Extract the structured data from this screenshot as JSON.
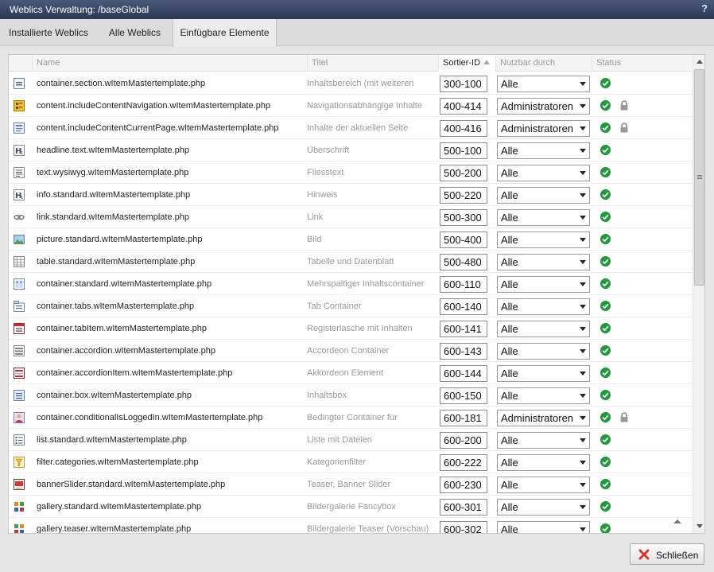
{
  "window": {
    "title": "Weblics Verwaltung: /baseGlobal",
    "help": "?"
  },
  "tabs": [
    {
      "label": "Installierte Weblics"
    },
    {
      "label": "Alle Weblics"
    },
    {
      "label": "Einfügbare Elemente"
    }
  ],
  "table": {
    "headers": {
      "name": "Name",
      "titel": "Titel",
      "sortier_id": "Sortier-ID",
      "nutzbar": "Nutzbar durch",
      "status": "Status"
    },
    "rows": [
      {
        "icon": "section-icon",
        "name": "container.section.wItemMastertemplate.php",
        "titel": "Inhaltsbereich (mit weiteren",
        "sortier_id": "300-100",
        "nutzbar": "Alle",
        "locked": false
      },
      {
        "icon": "navigation-content-icon",
        "name": "content.includeContentNavigation.wItemMastertemplate.php",
        "titel": "Navigationsabhängige Inhalte",
        "sortier_id": "400-414",
        "nutzbar": "Administratoren",
        "locked": true
      },
      {
        "icon": "page-content-icon",
        "name": "content.includeContentCurrentPage.wItemMastertemplate.php",
        "titel": "Inhalte der aktuellen Seite",
        "sortier_id": "400-416",
        "nutzbar": "Administratoren",
        "locked": true
      },
      {
        "icon": "headline-icon",
        "name": "headline.text.wItemMastertemplate.php",
        "titel": "Überschrift",
        "sortier_id": "500-100",
        "nutzbar": "Alle",
        "locked": false
      },
      {
        "icon": "text-icon",
        "name": "text.wysiwyg.wItemMastertemplate.php",
        "titel": "Fliesstext",
        "sortier_id": "500-200",
        "nutzbar": "Alle",
        "locked": false
      },
      {
        "icon": "headline-icon",
        "name": "info.standard.wItemMastertemplate.php",
        "titel": "Hinweis",
        "sortier_id": "500-220",
        "nutzbar": "Alle",
        "locked": false
      },
      {
        "icon": "link-icon",
        "name": "link.standard.wItemMastertemplate.php",
        "titel": "Link",
        "sortier_id": "500-300",
        "nutzbar": "Alle",
        "locked": false
      },
      {
        "icon": "picture-icon",
        "name": "picture.standard.wItemMastertemplate.php",
        "titel": "Bild",
        "sortier_id": "500-400",
        "nutzbar": "Alle",
        "locked": false
      },
      {
        "icon": "table-icon",
        "name": "table.standard.wItemMastertemplate.php",
        "titel": "Tabelle und Datenblatt",
        "sortier_id": "500-480",
        "nutzbar": "Alle",
        "locked": false
      },
      {
        "icon": "columns-icon",
        "name": "container.standard.wItemMastertemplate.php",
        "titel": "Mehrspaltiger Inhaltscontainer",
        "sortier_id": "600-110",
        "nutzbar": "Alle",
        "locked": false
      },
      {
        "icon": "tabs-icon",
        "name": "container.tabs.wItemMastertemplate.php",
        "titel": "Tab Container",
        "sortier_id": "600-140",
        "nutzbar": "Alle",
        "locked": false
      },
      {
        "icon": "tab-item-icon",
        "name": "container.tabItem.wItemMastertemplate.php",
        "titel": "Registerlasche mit Inhalten",
        "sortier_id": "600-141",
        "nutzbar": "Alle",
        "locked": false
      },
      {
        "icon": "accordion-icon",
        "name": "container.accordion.wItemMastertemplate.php",
        "titel": "Accordeon Container",
        "sortier_id": "600-143",
        "nutzbar": "Alle",
        "locked": false
      },
      {
        "icon": "accordion-item-icon",
        "name": "container.accordionItem.wItemMastertemplate.php",
        "titel": "Akkordeon Element",
        "sortier_id": "600-144",
        "nutzbar": "Alle",
        "locked": false
      },
      {
        "icon": "box-icon",
        "name": "container.box.wItemMastertemplate.php",
        "titel": "Inhaltsbox",
        "sortier_id": "600-150",
        "nutzbar": "Alle",
        "locked": false
      },
      {
        "icon": "user-icon",
        "name": "container.conditionalIsLoggedIn.wItemMastertemplate.php",
        "titel": "Bedingter Container für",
        "sortier_id": "600-181",
        "nutzbar": "Administratoren",
        "locked": true
      },
      {
        "icon": "list-icon",
        "name": "list.standard.wItemMastertemplate.php",
        "titel": "Liste mit Dateien",
        "sortier_id": "600-200",
        "nutzbar": "Alle",
        "locked": false
      },
      {
        "icon": "filter-icon",
        "name": "filter.categories.wItemMastertemplate.php",
        "titel": "Kategorienfilter",
        "sortier_id": "600-222",
        "nutzbar": "Alle",
        "locked": false
      },
      {
        "icon": "banner-slider-icon",
        "name": "bannerSlider.standard.wItemMastertemplate.php",
        "titel": "Teaser, Banner Slider",
        "sortier_id": "600-230",
        "nutzbar": "Alle",
        "locked": false
      },
      {
        "icon": "gallery-icon",
        "name": "gallery.standard.wItemMastertemplate.php",
        "titel": "Bildergalerie Fancybox",
        "sortier_id": "600-301",
        "nutzbar": "Alle",
        "locked": false
      },
      {
        "icon": "gallery-teaser-icon",
        "name": "gallery.teaser.wItemMastertemplate.php",
        "titel": "Bildergalerie Teaser (Vorschau)",
        "sortier_id": "600-302",
        "nutzbar": "Alle",
        "locked": false
      }
    ]
  },
  "footer": {
    "close_label": "Schließen"
  },
  "colors": {
    "status_ok": "#1f9a3a",
    "titlebar": "#2a3654",
    "close_icon": "#d9342b"
  }
}
